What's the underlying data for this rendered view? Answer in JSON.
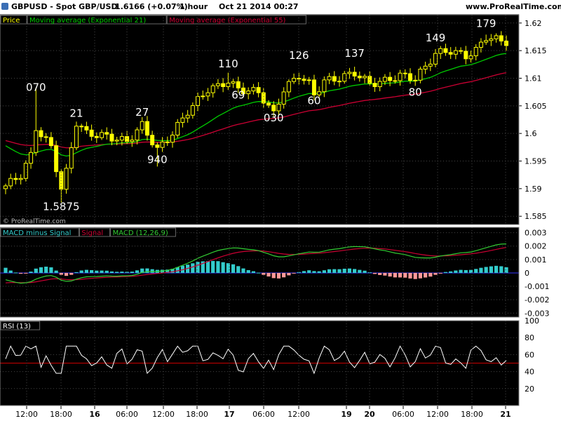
{
  "header": {
    "instrument": "GBPUSD - Spot GBP/USD",
    "price": "1.6166 (+0.07%)",
    "timeframe": "1 hour",
    "datetime": "Oct 21 2014 00:27",
    "website": "www.ProRealTime.com"
  },
  "colors": {
    "background": "#000000",
    "candle": "#ffff00",
    "ema21": "#00cc00",
    "ema55": "#cc0033",
    "macd_hist_pos": "#33cccc",
    "macd_hist_neg": "#ff9999",
    "macd_line": "#33cc33",
    "signal_line": "#cc0033",
    "rsi_line": "#ffffff",
    "rsi_level": "#cc0000"
  },
  "chart_data": [
    {
      "type": "candlestick",
      "panel": "price",
      "legend": [
        "Price",
        "Moving average (Exponential 21)",
        "Moving average (Exponential 55)"
      ],
      "y_ticks": [
        "1.62",
        "1.615",
        "1.61",
        "1.605",
        "1.6",
        "1.595",
        "1.59",
        "1.585"
      ],
      "ylim": [
        1.5835,
        1.6215
      ],
      "x_ticks": [
        "12:00",
        "18:00",
        "16",
        "06:00",
        "12:00",
        "18:00",
        "17",
        "06:00",
        "12:00",
        "19",
        "20",
        "06:00",
        "12:00",
        "18:00",
        "21"
      ],
      "watermark": "© ProRealTime.com",
      "annotations": [
        {
          "text": "070",
          "bar": 6,
          "price": 1.6077
        },
        {
          "text": "21",
          "bar": 14,
          "price": 1.603
        },
        {
          "text": "1.5875",
          "bar": 11,
          "price": 1.5861
        },
        {
          "text": "27",
          "bar": 27,
          "price": 1.6032
        },
        {
          "text": "940",
          "bar": 30,
          "price": 1.5946
        },
        {
          "text": "110",
          "bar": 44,
          "price": 1.612
        },
        {
          "text": "69",
          "bar": 46,
          "price": 1.6063
        },
        {
          "text": "030",
          "bar": 53,
          "price": 1.6022
        },
        {
          "text": "126",
          "bar": 58,
          "price": 1.6135
        },
        {
          "text": "60",
          "bar": 61,
          "price": 1.6053
        },
        {
          "text": "137",
          "bar": 69,
          "price": 1.6139
        },
        {
          "text": "80",
          "bar": 81,
          "price": 1.6068
        },
        {
          "text": "149",
          "bar": 85,
          "price": 1.6167
        },
        {
          "text": "179",
          "bar": 95,
          "price": 1.6193
        }
      ]
    },
    {
      "type": "line",
      "panel": "macd",
      "legend": [
        "MACD minus Signal",
        "Signal",
        "MACD (12,26,9)"
      ],
      "y_ticks": [
        "0.003",
        "0.002",
        "0.001",
        "0",
        "-0.001",
        "-0.002",
        "-0.003"
      ],
      "ylim": [
        -0.0033,
        0.0034
      ]
    },
    {
      "type": "line",
      "panel": "rsi",
      "legend": [
        "RSI (13)"
      ],
      "y_ticks": [
        "100",
        "80",
        "60",
        "40",
        "20"
      ],
      "ylim": [
        0,
        100
      ],
      "level": 50
    }
  ]
}
